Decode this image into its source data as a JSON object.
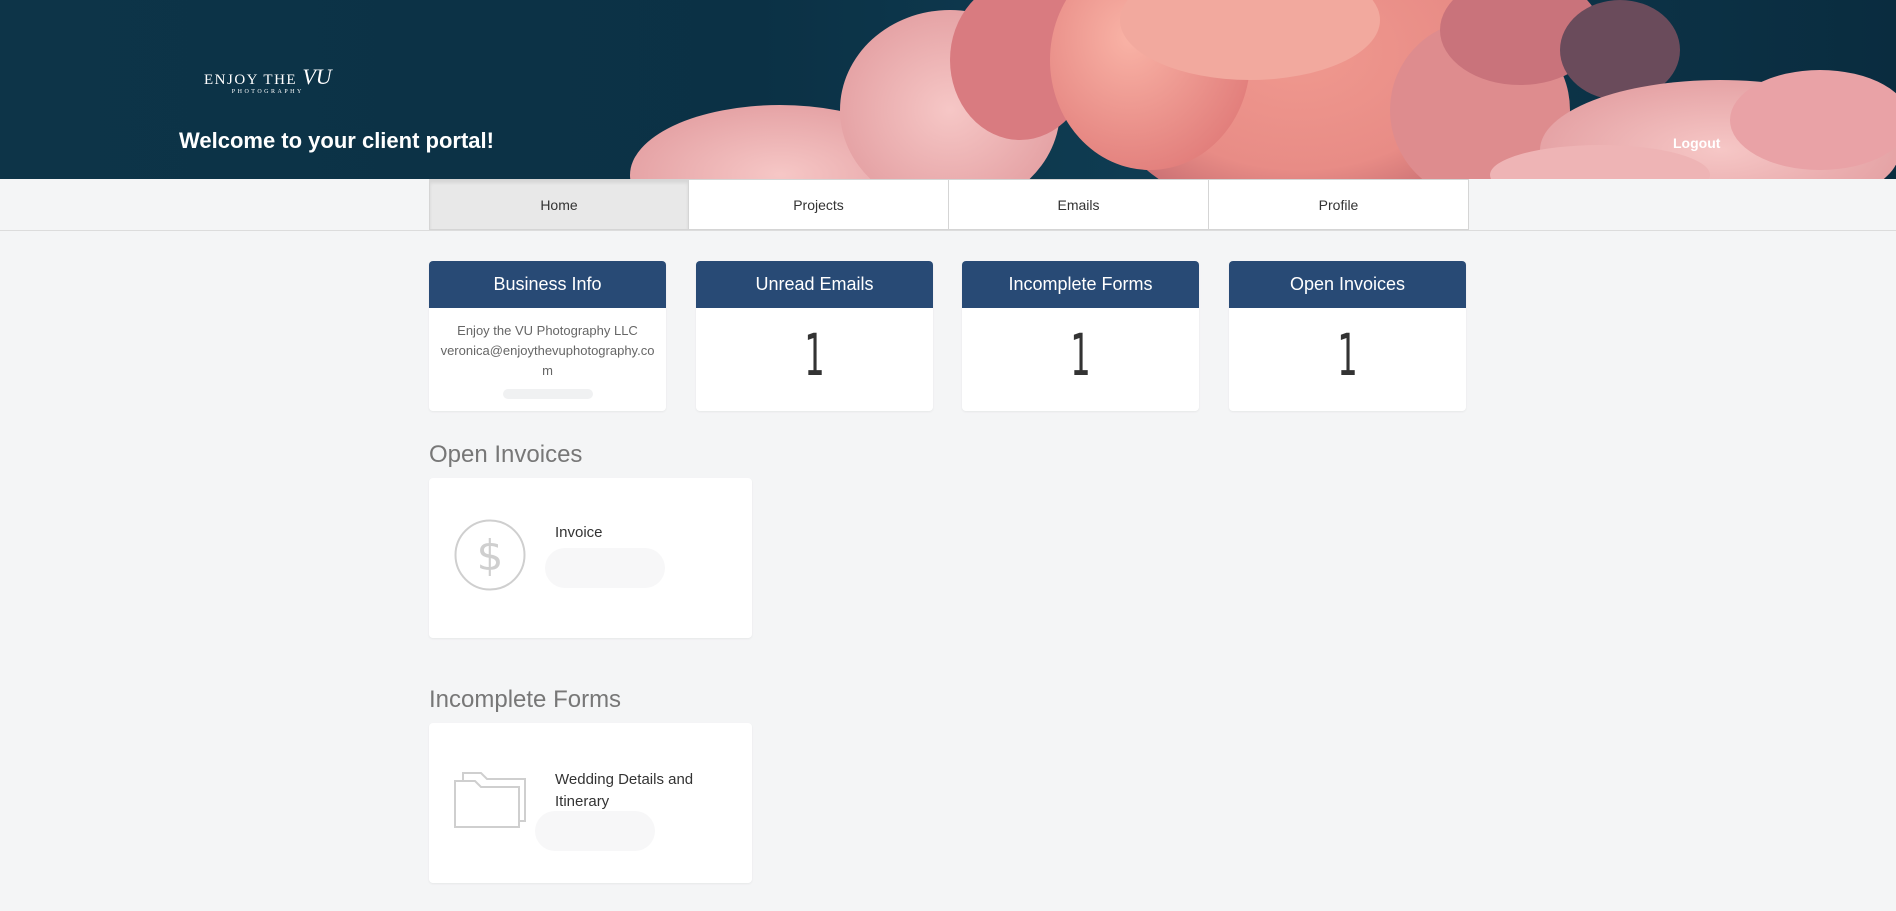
{
  "header": {
    "logo_main": "ENJOY THE",
    "logo_script": "VU",
    "logo_sub": "PHOTOGRAPHY",
    "welcome": "Welcome to your client portal!",
    "logout": "Logout"
  },
  "nav": {
    "tabs": [
      {
        "label": "Home"
      },
      {
        "label": "Projects"
      },
      {
        "label": "Emails"
      },
      {
        "label": "Profile"
      }
    ],
    "active": "Home"
  },
  "cards": {
    "business": {
      "title": "Business Info",
      "company": "Enjoy the VU Photography LLC",
      "email": "veronica@enjoythevuphotography.com"
    },
    "unread": {
      "title": "Unread Emails",
      "count": "1"
    },
    "forms": {
      "title": "Incomplete Forms",
      "count": "1"
    },
    "invoices": {
      "title": "Open Invoices",
      "count": "1"
    }
  },
  "sections": {
    "open_invoices": {
      "title": "Open Invoices",
      "items": [
        {
          "label": "Invoice",
          "icon": "dollar-icon"
        }
      ]
    },
    "incomplete_forms": {
      "title": "Incomplete Forms",
      "items": [
        {
          "label": "Wedding Details and Itinerary",
          "icon": "folder-icon"
        }
      ]
    }
  },
  "colors": {
    "header_bg": "#0d3448",
    "card_header": "#284a75",
    "page_bg": "#f4f5f6"
  }
}
